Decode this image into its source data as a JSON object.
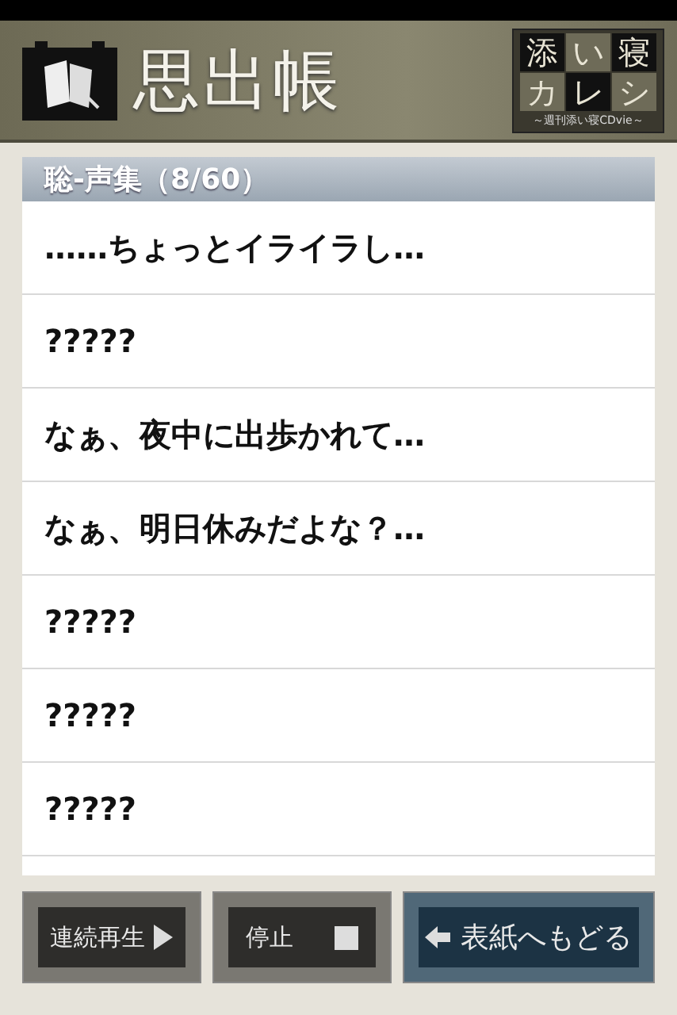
{
  "header": {
    "title": "思出帳",
    "logo": {
      "cells": [
        "添",
        "い",
        "寝",
        "カ",
        "レ",
        "シ"
      ],
      "subtitle": "～週刊添い寝CDvie～"
    }
  },
  "section": {
    "title": "聡-声集（8/60）"
  },
  "rows": [
    {
      "text": "……ちょっとイライラし…"
    },
    {
      "text": "?????"
    },
    {
      "text": "なぁ、夜中に出歩かれて…"
    },
    {
      "text": "なぁ、明日休みだよな？…"
    },
    {
      "text": "?????"
    },
    {
      "text": "?????"
    },
    {
      "text": "?????"
    }
  ],
  "buttons": [
    {
      "kind": "play",
      "label": "連続再生"
    },
    {
      "kind": "stop",
      "label": "停止"
    },
    {
      "kind": "back",
      "label": "表紙へもどる"
    }
  ]
}
